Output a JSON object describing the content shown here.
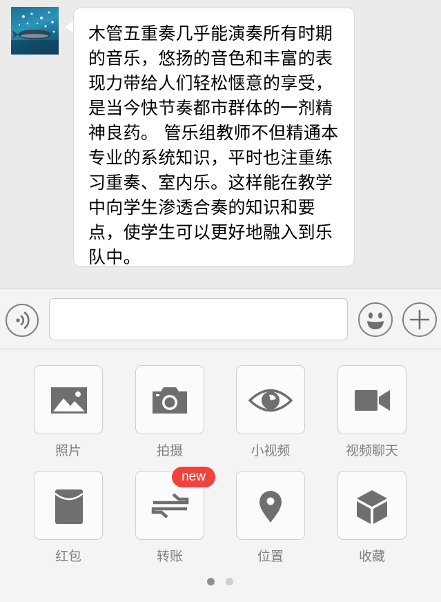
{
  "message": {
    "text": "木管五重奏几乎能演奏所有时期的音乐，悠扬的音色和丰富的表现力带给人们轻松惬意的享受，是当今快节奏都市群体的一剂精神良药。 管乐组教师不但精通本专业的系统知识，平时也注重练习重奏、室内乐。这样能在教学中向学生渗透合奏的知识和要点，使学生可以更好地融入到乐队中。"
  },
  "input_bar": {
    "text_value": ""
  },
  "tools": [
    {
      "label": "照片",
      "icon": "photo-icon"
    },
    {
      "label": "拍摄",
      "icon": "camera-icon"
    },
    {
      "label": "小视频",
      "icon": "eye-icon"
    },
    {
      "label": "视频聊天",
      "icon": "video-call-icon"
    },
    {
      "label": "红包",
      "icon": "red-packet-icon"
    },
    {
      "label": "转账",
      "icon": "transfer-icon",
      "badge": "new"
    },
    {
      "label": "位置",
      "icon": "location-pin-icon"
    },
    {
      "label": "收藏",
      "icon": "favorites-box-icon"
    }
  ],
  "pagination": {
    "total_pages": 2,
    "current_page": 1
  },
  "colors": {
    "badge": "#f2423c",
    "icon_gray": "#6f6f6f",
    "dot_active": "#8e8e8e",
    "dot_inactive": "#cfcfcf"
  }
}
